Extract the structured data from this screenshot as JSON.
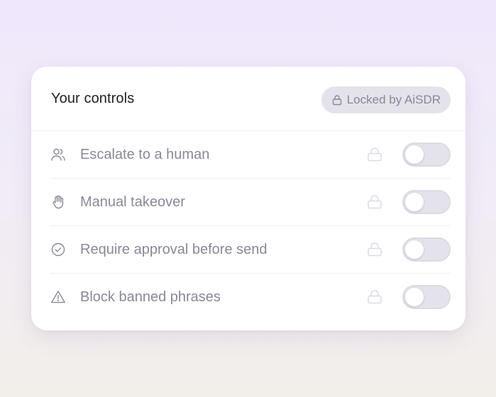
{
  "card": {
    "title": "Your controls",
    "badge": {
      "icon": "lock-icon",
      "label": "Locked by AiSDR"
    }
  },
  "controls": [
    {
      "icon": "users-icon",
      "label": "Escalate to a human",
      "locked": true,
      "enabled": false
    },
    {
      "icon": "hand-icon",
      "label": "Manual takeover",
      "locked": true,
      "enabled": false
    },
    {
      "icon": "check-circle-icon",
      "label": "Require approval before send",
      "locked": true,
      "enabled": false
    },
    {
      "icon": "warning-triangle-icon",
      "label": "Block banned phrases",
      "locked": true,
      "enabled": false
    }
  ],
  "colors": {
    "text_primary": "#1f1f25",
    "text_muted": "#8a8898",
    "badge_bg": "#e4e2ea",
    "toggle_off": "#e4e2ea",
    "background_top": "#efe8fc",
    "background_bottom": "#f2eeea"
  }
}
